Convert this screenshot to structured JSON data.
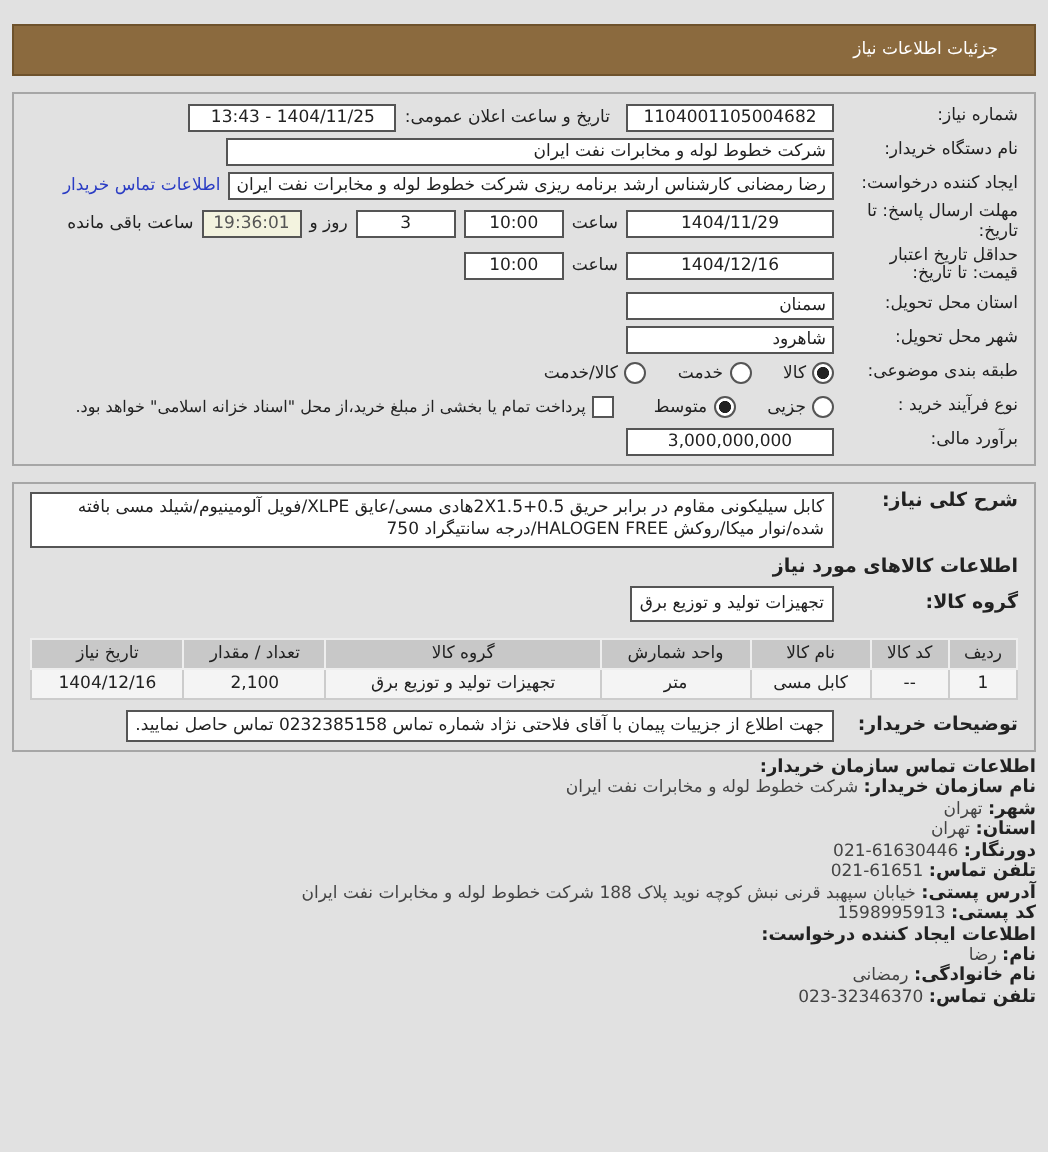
{
  "header": {
    "title": "جزئیات اطلاعات نیاز"
  },
  "details": {
    "need_number": {
      "label": "شماره نیاز:",
      "value": "1104001105004682"
    },
    "announce": {
      "label": "تاریخ و ساعت اعلان عمومی:",
      "value": "1404/11/25 - 13:43"
    },
    "buyer_org": {
      "label": "نام دستگاه خریدار:",
      "value": "شرکت خطوط لوله و مخابرات نفت ایران"
    },
    "requester": {
      "label": "ایجاد کننده درخواست:",
      "value": "رضا رمضانی کارشناس ارشد برنامه ریزی  شرکت خطوط لوله و مخابرات نفت ایران",
      "link": "اطلاعات تماس خریدار"
    },
    "deadline": {
      "label": "مهلت ارسال پاسخ: تا تاریخ:",
      "date": "1404/11/29",
      "time_label": "ساعت",
      "time": "10:00",
      "days": "3",
      "days_label": "روز و",
      "remaining": "19:36:01",
      "remaining_label": "ساعت باقی مانده"
    },
    "validity": {
      "label": "حداقل تاریخ اعتبار قیمت: تا تاریخ:",
      "date": "1404/12/16",
      "time_label": "ساعت",
      "time": "10:00"
    },
    "province": {
      "label": "استان محل تحویل:",
      "value": "سمنان"
    },
    "city": {
      "label": "شهر محل تحویل:",
      "value": "شاهرود"
    },
    "category": {
      "label": "طبقه بندی موضوعی:",
      "options": [
        {
          "label": "کالا",
          "selected": true
        },
        {
          "label": "خدمت",
          "selected": false
        },
        {
          "label": "کالا/خدمت",
          "selected": false
        }
      ]
    },
    "process": {
      "label": "نوع فرآیند خرید :",
      "options": [
        {
          "label": "جزیی",
          "selected": false
        },
        {
          "label": "متوسط",
          "selected": true
        }
      ],
      "treasury": {
        "label": "پرداخت تمام یا بخشی از مبلغ خرید،از محل \"اسناد خزانه اسلامی\" خواهد بود.",
        "checked": false
      }
    },
    "estimate": {
      "label": "برآورد مالی:",
      "value": "3,000,000,000"
    }
  },
  "goods": {
    "description": {
      "label": "شرح کلی نیاز:",
      "value": "کابل سیلیکونی مقاوم در برابر حریق 2X1.5+0.5هادی مسی/عایق XLPE/فویل آلومینیوم/شیلد مسی بافته شده/نوار میکا/روکش HALOGEN FREE/درجه سانتیگراد 750"
    },
    "section_title": "اطلاعات کالاهای مورد نیاز",
    "group": {
      "label": "گروه کالا:",
      "value": "تجهیزات تولید و توزیع برق"
    },
    "table": {
      "columns": [
        "ردیف",
        "کد کالا",
        "نام کالا",
        "واحد شمارش",
        "گروه کالا",
        "تعداد / مقدار",
        "تاریخ نیاز"
      ],
      "rows": [
        [
          "1",
          "--",
          "کابل مسی",
          "متر",
          "تجهیزات تولید و توزیع برق",
          "2,100",
          "1404/12/16"
        ]
      ]
    },
    "notes": {
      "label": "توضیحات خریدار:",
      "value": "جهت اطلاع از جزییات پیمان با آقای فلاحتی نژاد شماره تماس 0232385158 تماس حاصل نمایید."
    }
  },
  "contact": [
    {
      "kind": "heading",
      "text": "اطلاعات تماس سازمان خریدار:"
    },
    {
      "kind": "line",
      "label": "نام سازمان خریدار:",
      "value": "شرکت خطوط لوله و مخابرات نفت ایران"
    },
    {
      "kind": "line",
      "label": "شهر:",
      "value": "تهران"
    },
    {
      "kind": "line",
      "label": "استان:",
      "value": "تهران"
    },
    {
      "kind": "line",
      "label": "دورنگار:",
      "value": "61630446-021"
    },
    {
      "kind": "line",
      "label": "تلفن تماس:",
      "value": "61651-021"
    },
    {
      "kind": "line",
      "label": "آدرس پستی:",
      "value": "خیابان سپهبد قرنی نبش کوچه نوید پلاک 188 شرکت خطوط لوله و مخابرات نفت ایران"
    },
    {
      "kind": "line",
      "label": "کد پستی:",
      "value": "1598995913"
    },
    {
      "kind": "heading",
      "text": "اطلاعات ایجاد کننده درخواست:"
    },
    {
      "kind": "line",
      "label": "نام:",
      "value": "رضا"
    },
    {
      "kind": "line",
      "label": "نام خانوادگی:",
      "value": "رمضانی"
    },
    {
      "kind": "line",
      "label": "تلفن تماس:",
      "value": "32346370-023"
    }
  ]
}
